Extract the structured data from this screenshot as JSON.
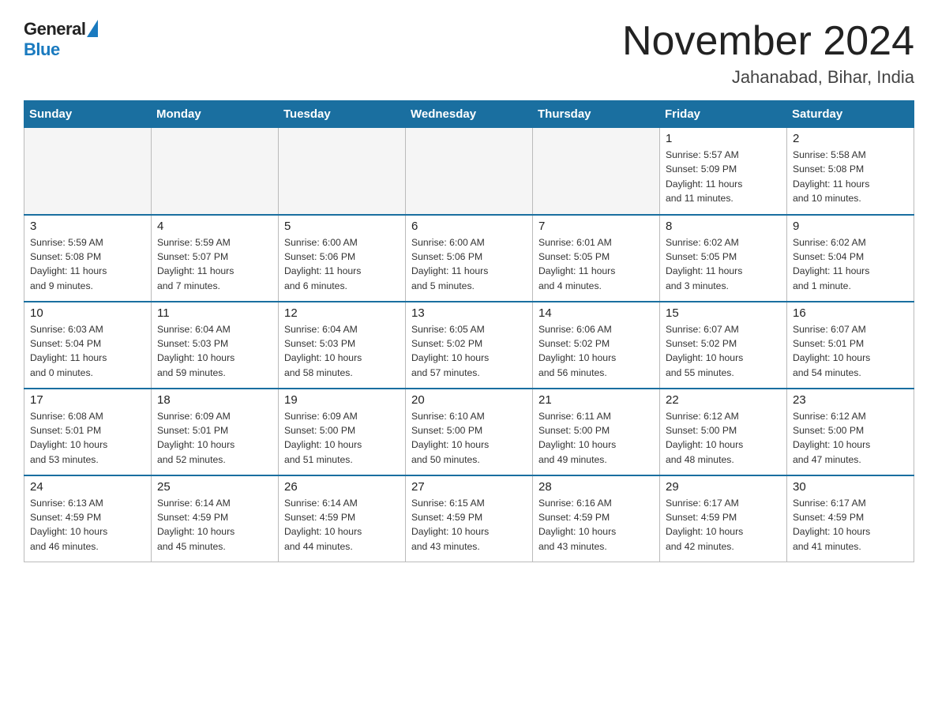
{
  "logo": {
    "general": "General",
    "blue": "Blue"
  },
  "title": "November 2024",
  "location": "Jahanabad, Bihar, India",
  "weekdays": [
    "Sunday",
    "Monday",
    "Tuesday",
    "Wednesday",
    "Thursday",
    "Friday",
    "Saturday"
  ],
  "rows": [
    [
      {
        "day": "",
        "info": ""
      },
      {
        "day": "",
        "info": ""
      },
      {
        "day": "",
        "info": ""
      },
      {
        "day": "",
        "info": ""
      },
      {
        "day": "",
        "info": ""
      },
      {
        "day": "1",
        "info": "Sunrise: 5:57 AM\nSunset: 5:09 PM\nDaylight: 11 hours\nand 11 minutes."
      },
      {
        "day": "2",
        "info": "Sunrise: 5:58 AM\nSunset: 5:08 PM\nDaylight: 11 hours\nand 10 minutes."
      }
    ],
    [
      {
        "day": "3",
        "info": "Sunrise: 5:59 AM\nSunset: 5:08 PM\nDaylight: 11 hours\nand 9 minutes."
      },
      {
        "day": "4",
        "info": "Sunrise: 5:59 AM\nSunset: 5:07 PM\nDaylight: 11 hours\nand 7 minutes."
      },
      {
        "day": "5",
        "info": "Sunrise: 6:00 AM\nSunset: 5:06 PM\nDaylight: 11 hours\nand 6 minutes."
      },
      {
        "day": "6",
        "info": "Sunrise: 6:00 AM\nSunset: 5:06 PM\nDaylight: 11 hours\nand 5 minutes."
      },
      {
        "day": "7",
        "info": "Sunrise: 6:01 AM\nSunset: 5:05 PM\nDaylight: 11 hours\nand 4 minutes."
      },
      {
        "day": "8",
        "info": "Sunrise: 6:02 AM\nSunset: 5:05 PM\nDaylight: 11 hours\nand 3 minutes."
      },
      {
        "day": "9",
        "info": "Sunrise: 6:02 AM\nSunset: 5:04 PM\nDaylight: 11 hours\nand 1 minute."
      }
    ],
    [
      {
        "day": "10",
        "info": "Sunrise: 6:03 AM\nSunset: 5:04 PM\nDaylight: 11 hours\nand 0 minutes."
      },
      {
        "day": "11",
        "info": "Sunrise: 6:04 AM\nSunset: 5:03 PM\nDaylight: 10 hours\nand 59 minutes."
      },
      {
        "day": "12",
        "info": "Sunrise: 6:04 AM\nSunset: 5:03 PM\nDaylight: 10 hours\nand 58 minutes."
      },
      {
        "day": "13",
        "info": "Sunrise: 6:05 AM\nSunset: 5:02 PM\nDaylight: 10 hours\nand 57 minutes."
      },
      {
        "day": "14",
        "info": "Sunrise: 6:06 AM\nSunset: 5:02 PM\nDaylight: 10 hours\nand 56 minutes."
      },
      {
        "day": "15",
        "info": "Sunrise: 6:07 AM\nSunset: 5:02 PM\nDaylight: 10 hours\nand 55 minutes."
      },
      {
        "day": "16",
        "info": "Sunrise: 6:07 AM\nSunset: 5:01 PM\nDaylight: 10 hours\nand 54 minutes."
      }
    ],
    [
      {
        "day": "17",
        "info": "Sunrise: 6:08 AM\nSunset: 5:01 PM\nDaylight: 10 hours\nand 53 minutes."
      },
      {
        "day": "18",
        "info": "Sunrise: 6:09 AM\nSunset: 5:01 PM\nDaylight: 10 hours\nand 52 minutes."
      },
      {
        "day": "19",
        "info": "Sunrise: 6:09 AM\nSunset: 5:00 PM\nDaylight: 10 hours\nand 51 minutes."
      },
      {
        "day": "20",
        "info": "Sunrise: 6:10 AM\nSunset: 5:00 PM\nDaylight: 10 hours\nand 50 minutes."
      },
      {
        "day": "21",
        "info": "Sunrise: 6:11 AM\nSunset: 5:00 PM\nDaylight: 10 hours\nand 49 minutes."
      },
      {
        "day": "22",
        "info": "Sunrise: 6:12 AM\nSunset: 5:00 PM\nDaylight: 10 hours\nand 48 minutes."
      },
      {
        "day": "23",
        "info": "Sunrise: 6:12 AM\nSunset: 5:00 PM\nDaylight: 10 hours\nand 47 minutes."
      }
    ],
    [
      {
        "day": "24",
        "info": "Sunrise: 6:13 AM\nSunset: 4:59 PM\nDaylight: 10 hours\nand 46 minutes."
      },
      {
        "day": "25",
        "info": "Sunrise: 6:14 AM\nSunset: 4:59 PM\nDaylight: 10 hours\nand 45 minutes."
      },
      {
        "day": "26",
        "info": "Sunrise: 6:14 AM\nSunset: 4:59 PM\nDaylight: 10 hours\nand 44 minutes."
      },
      {
        "day": "27",
        "info": "Sunrise: 6:15 AM\nSunset: 4:59 PM\nDaylight: 10 hours\nand 43 minutes."
      },
      {
        "day": "28",
        "info": "Sunrise: 6:16 AM\nSunset: 4:59 PM\nDaylight: 10 hours\nand 43 minutes."
      },
      {
        "day": "29",
        "info": "Sunrise: 6:17 AM\nSunset: 4:59 PM\nDaylight: 10 hours\nand 42 minutes."
      },
      {
        "day": "30",
        "info": "Sunrise: 6:17 AM\nSunset: 4:59 PM\nDaylight: 10 hours\nand 41 minutes."
      }
    ]
  ]
}
